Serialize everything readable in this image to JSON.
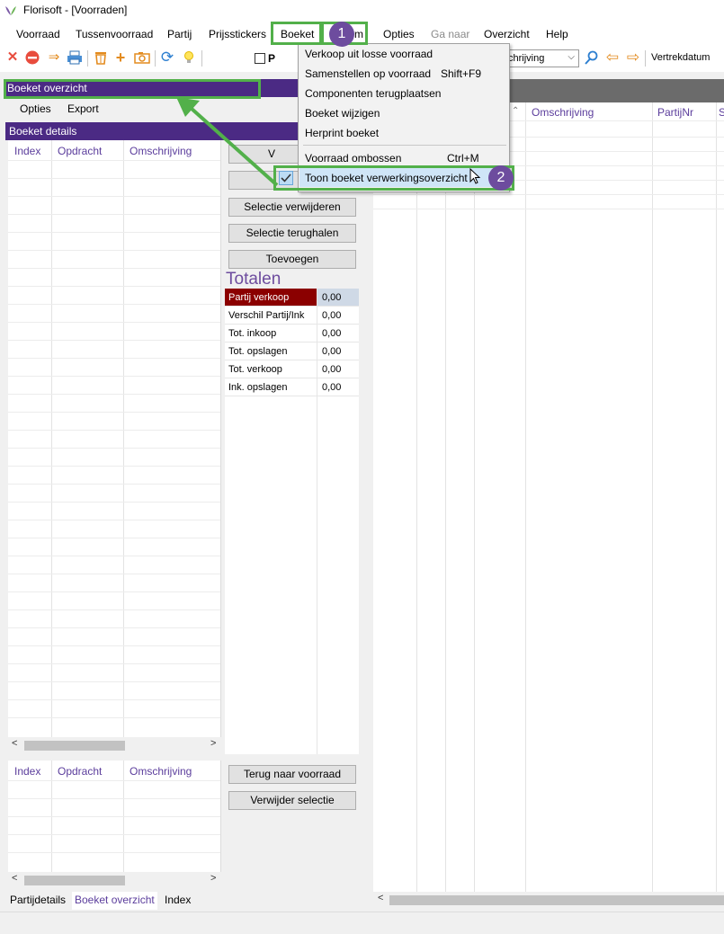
{
  "window": {
    "title": "Florisoft - [Voorraden]"
  },
  "menubar": {
    "items": [
      "Voorraad",
      "Tussenvoorraad",
      "Partij",
      "Prijsstickers",
      "Boeket",
      "Systeem",
      "Opties",
      "Ga naar",
      "Overzicht",
      "Help"
    ],
    "partial_item": "m"
  },
  "toolbar": {
    "checkbox_label": "P",
    "combo_value": "chrijving",
    "vertrekdatum_label": "Vertrekdatum"
  },
  "dropdown": {
    "items": [
      {
        "label": "Verkoop uit losse voorraad",
        "shortcut": ""
      },
      {
        "label": "Samenstellen op voorraad",
        "shortcut": "Shift+F9"
      },
      {
        "label": "Componenten terugplaatsen",
        "shortcut": ""
      },
      {
        "label": "Boeket wijzigen",
        "shortcut": ""
      },
      {
        "label": "Herprint boeket",
        "shortcut": ""
      },
      {
        "label": "Voorraad ombossen",
        "shortcut": "Ctrl+M"
      },
      {
        "label": "Toon boeket verwerkingsoverzicht",
        "shortcut": "",
        "checked": true
      }
    ]
  },
  "left_panel": {
    "header": "Boeket overzicht",
    "submenu": [
      "Opties",
      "Export"
    ],
    "details_header": "Boeket details",
    "columns": [
      "Index",
      "Opdracht",
      "Omschrijving"
    ],
    "bottom_columns": [
      "Index",
      "Opdracht",
      "Omschrijving"
    ]
  },
  "middle_panel": {
    "partial_button_label": "V",
    "buttons": [
      "Selectie verwijderen",
      "Selectie terughalen",
      "Toevoegen"
    ],
    "totals_title": "Totalen",
    "totals": [
      {
        "label": "Partij verkoop",
        "value": "0,00"
      },
      {
        "label": "Verschil Partij/Ink",
        "value": "0,00"
      },
      {
        "label": "Tot. inkoop",
        "value": "0,00"
      },
      {
        "label": "Tot. opslagen",
        "value": "0,00"
      },
      {
        "label": "Tot. verkoop",
        "value": "0,00"
      },
      {
        "label": "Ink. opslagen",
        "value": "0,00"
      }
    ],
    "bottom_buttons": [
      "Terug naar voorraad",
      "Verwijder selectie"
    ]
  },
  "right_grid": {
    "columns": [
      "Omschrijving",
      "PartijNr",
      "S"
    ]
  },
  "bottom_tabs": [
    "Partijdetails",
    "Boeket overzicht",
    "Index"
  ],
  "callouts": [
    "1",
    "2"
  ],
  "colors": {
    "accent_purple": "#4b2a84",
    "header_text_purple": "#5b3d9c",
    "highlight_green": "#52b04a",
    "badge_purple": "#6d4c9e",
    "totals_selected": "#8b0000"
  }
}
